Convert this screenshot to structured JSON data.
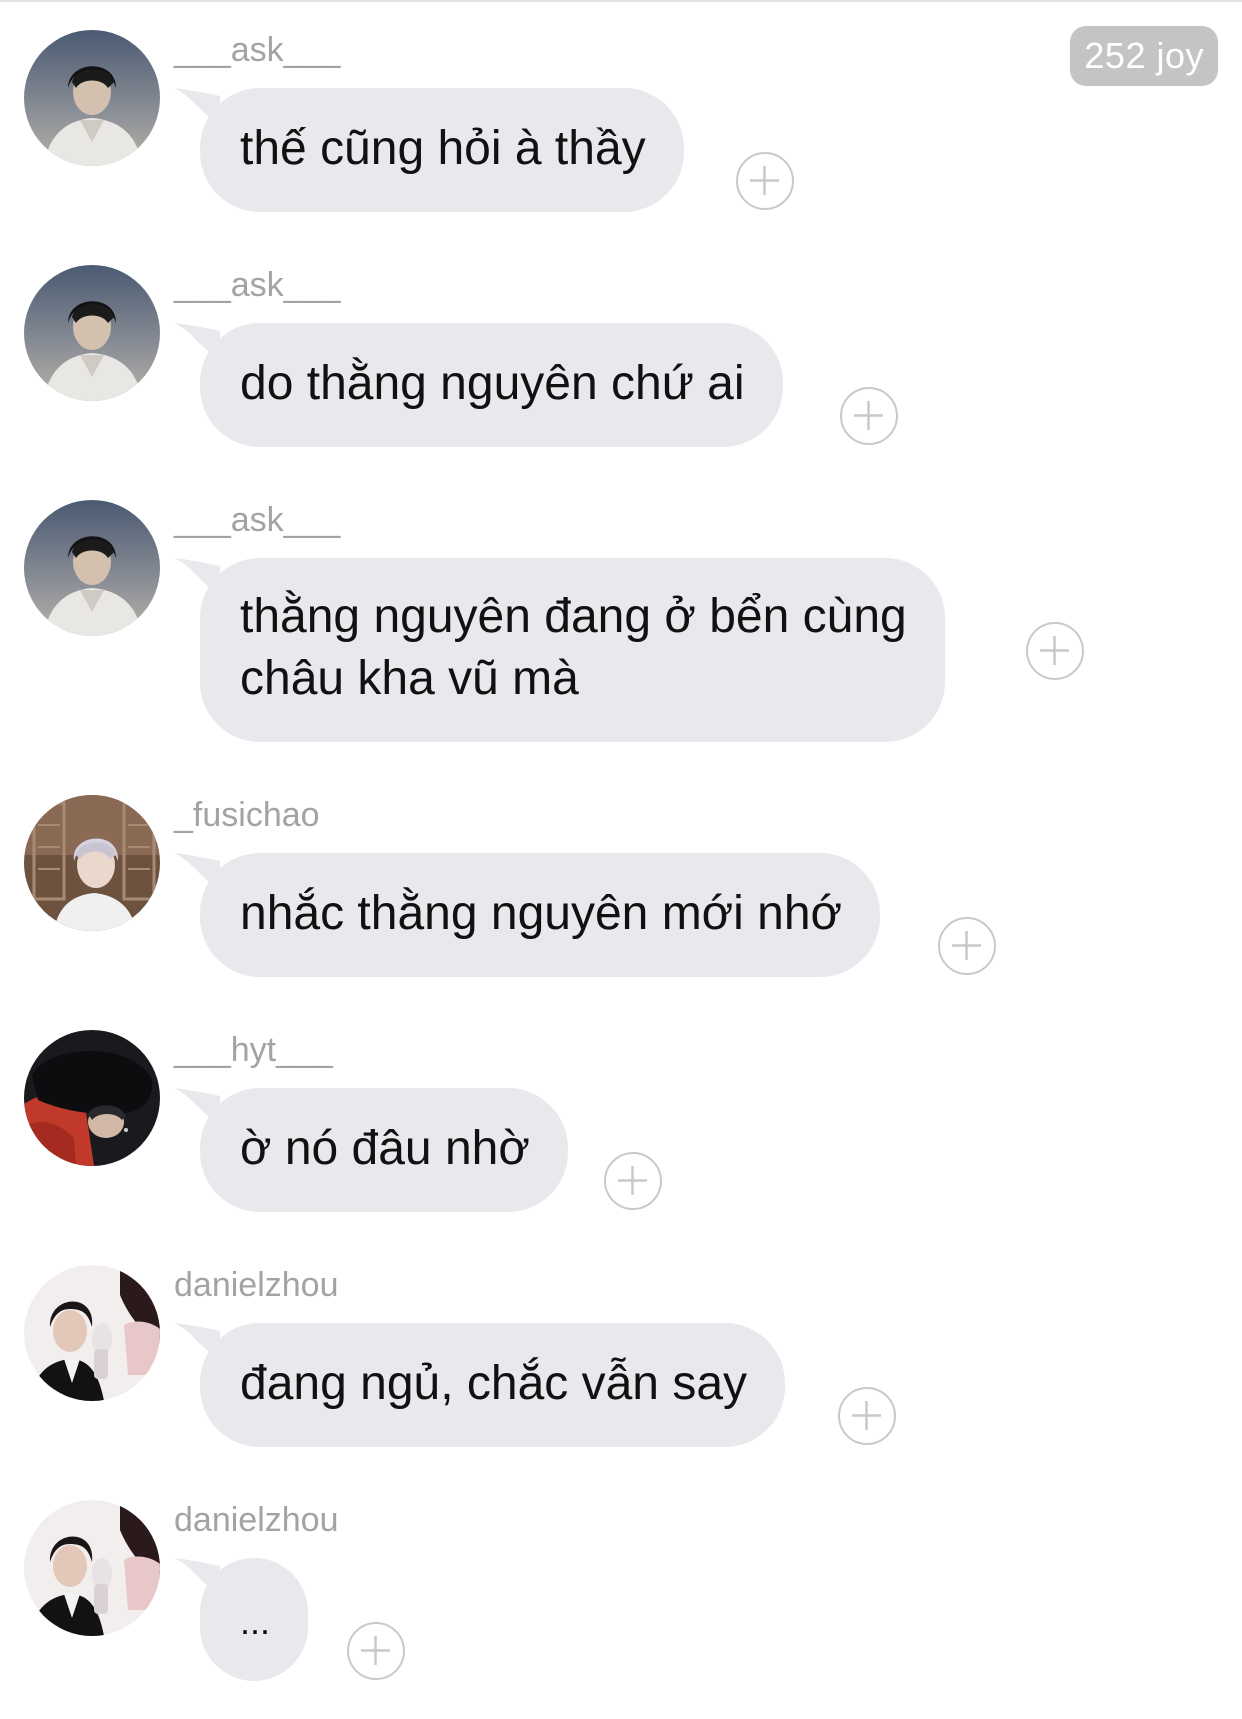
{
  "header": {
    "counter_badge": "252 joy"
  },
  "messages": [
    {
      "username": "___ask___",
      "text": "thế cũng hỏi à thầy",
      "avatar": "avatar-ask"
    },
    {
      "username": "___ask___",
      "text": "do thằng nguyên chứ ai",
      "avatar": "avatar-ask"
    },
    {
      "username": "___ask___",
      "text": "thằng nguyên đang ở bển cùng\nchâu kha vũ mà",
      "avatar": "avatar-ask"
    },
    {
      "username": "_fusichao",
      "text": "nhắc thằng nguyên mới nhớ",
      "avatar": "avatar-fusichao"
    },
    {
      "username": "___hyt___",
      "text": "ờ nó đâu nhờ",
      "avatar": "avatar-hyt"
    },
    {
      "username": "danielzhou",
      "text": "đang ngủ, chắc vẫn say",
      "avatar": "avatar-danielzhou"
    },
    {
      "username": "danielzhou",
      "text": "...",
      "avatar": "avatar-danielzhou"
    }
  ],
  "icons": {
    "reaction": "plus-circle-icon"
  },
  "colors": {
    "bubble": "#e8e9ec",
    "username": "#a3a3a3",
    "badge": "#c4c4c4",
    "plus": "#c9c9c9"
  }
}
